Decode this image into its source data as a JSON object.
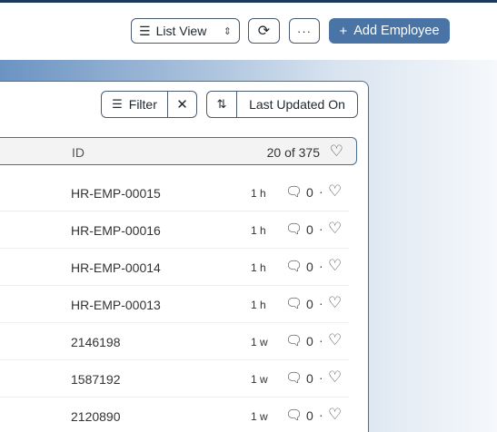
{
  "toolbar": {
    "list_view_label": "List View",
    "list_view_icon": "☰",
    "list_view_caret": "⌃⌄",
    "refresh_icon": "⟳",
    "more_icon": "···",
    "add_plus": "+",
    "add_label": "Add Employee"
  },
  "filters": {
    "filter_icon": "☰",
    "filter_label": "Filter",
    "clear_icon": "✕",
    "sort_icon": "⇅",
    "sort_label": "Last Updated On"
  },
  "list": {
    "id_header": "ID",
    "count": "20 of 375",
    "heart_icon": "♡",
    "rows": [
      {
        "id": "HR-EMP-00015",
        "time": "1 h",
        "comments": "0"
      },
      {
        "id": "HR-EMP-00016",
        "time": "1 h",
        "comments": "0"
      },
      {
        "id": "HR-EMP-00014",
        "time": "1 h",
        "comments": "0"
      },
      {
        "id": "HR-EMP-00013",
        "time": "1 h",
        "comments": "0"
      },
      {
        "id": "2146198",
        "time": "1 w",
        "comments": "0"
      },
      {
        "id": "1587192",
        "time": "1 w",
        "comments": "0"
      },
      {
        "id": "2120890",
        "time": "1 w",
        "comments": "0"
      }
    ]
  }
}
